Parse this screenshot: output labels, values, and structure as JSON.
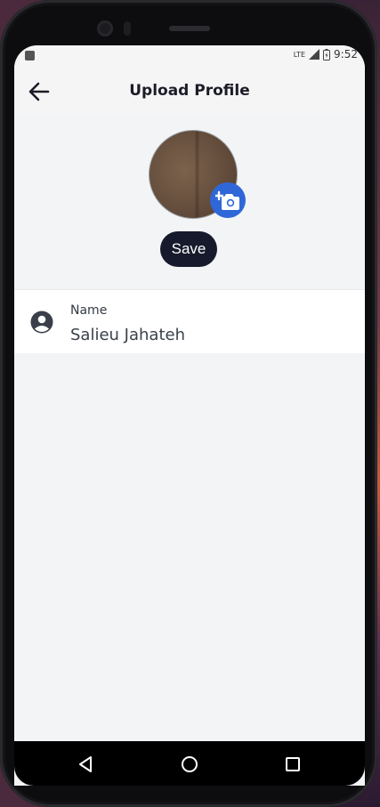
{
  "status_bar": {
    "network": "LTE",
    "time": "9:52"
  },
  "app_bar": {
    "title": "Upload Profile",
    "back_icon": "arrow-left-icon"
  },
  "profile": {
    "avatar": "profile-photo",
    "camera_badge_icon": "add-camera-icon",
    "save_label": "Save"
  },
  "name_field": {
    "icon": "account-circle-icon",
    "label": "Name",
    "value": "Salieu Jahateh"
  },
  "nav_bar": {
    "icons": [
      "back-triangle-icon",
      "home-circle-icon",
      "recents-square-icon"
    ]
  },
  "colors": {
    "primary": "#2f67d8",
    "button_dark": "#171a2c",
    "screen_bg": "#f2f4f6",
    "text_dark": "#1c1c28"
  }
}
